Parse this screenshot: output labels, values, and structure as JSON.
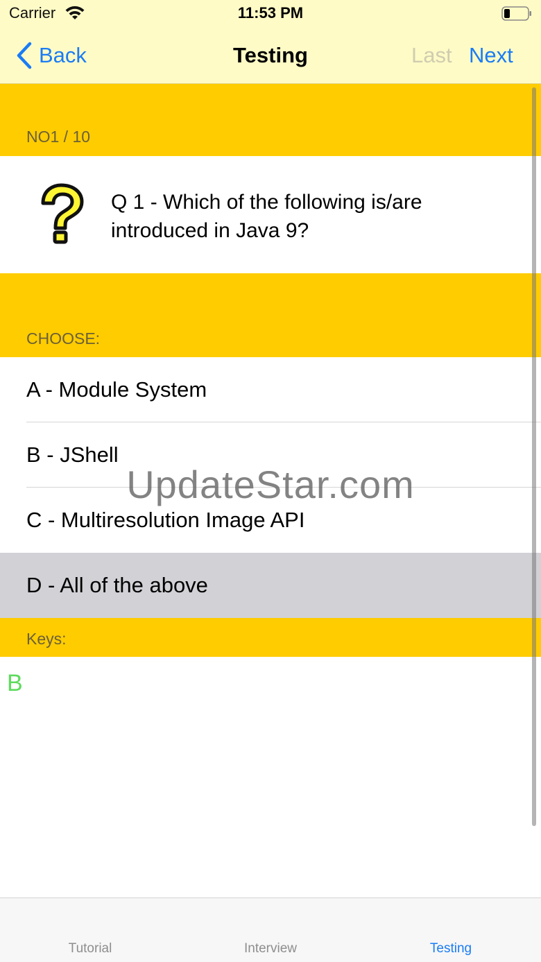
{
  "status_bar": {
    "carrier": "Carrier",
    "time": "11:53 PM",
    "wifi_icon": "wifi-icon",
    "battery_icon": "battery-icon"
  },
  "nav": {
    "back_label": "Back",
    "title": "Testing",
    "last_label": "Last",
    "next_label": "Next",
    "back_icon": "chevron-left-icon"
  },
  "progress": {
    "label": "NO1 / 10"
  },
  "question": {
    "icon": "question-mark-icon",
    "text": "Q 1 - Which of the following is/are introduced in Java 9?"
  },
  "choose_header": "CHOOSE:",
  "options": [
    {
      "label": "A - Module System",
      "selected": false
    },
    {
      "label": "B - JShell",
      "selected": false
    },
    {
      "label": "C - Multiresolution Image API",
      "selected": false
    },
    {
      "label": "D - All of the above",
      "selected": true
    }
  ],
  "keys_header": "Keys:",
  "key_answer": "B",
  "watermark": "UpdateStar.com",
  "tabs": [
    {
      "label": "Tutorial",
      "active": false
    },
    {
      "label": "Interview",
      "active": false
    },
    {
      "label": "Testing",
      "active": true
    }
  ],
  "colors": {
    "nav_background": "#fffbc6",
    "section_header": "#ffcc00",
    "accent_blue": "#1a7cf5",
    "selected_row": "#d1d1d6",
    "key_green": "#5ddb5d",
    "disabled_text": "#d0ccb0"
  }
}
